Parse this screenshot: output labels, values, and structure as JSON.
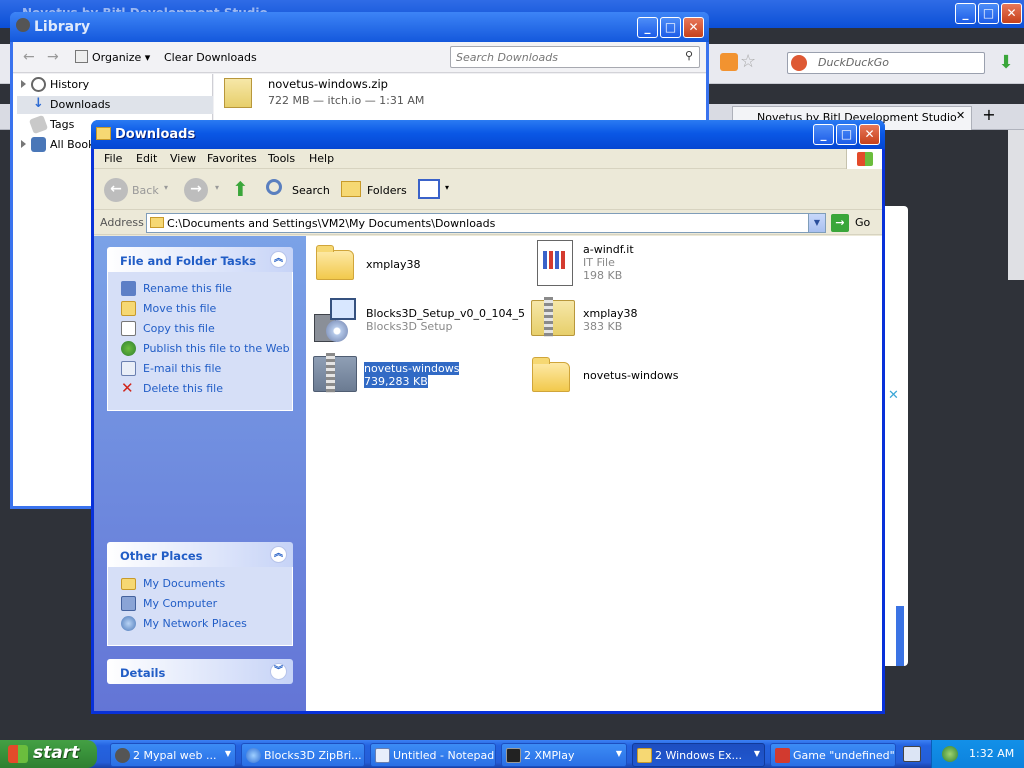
{
  "firefox": {
    "search_placeholder": "DuckDuckGo",
    "tab_label": "Novetus by Bitl Development Studio"
  },
  "library": {
    "title": "Library",
    "organize_label": "Organize",
    "clear_label": "Clear Downloads",
    "search_placeholder": "Search Downloads",
    "tree": [
      {
        "label": "History"
      },
      {
        "label": "Downloads"
      },
      {
        "label": "Tags"
      },
      {
        "label": "All Bookmarks"
      }
    ],
    "download": {
      "name": "novetus-windows.zip",
      "meta": "722 MB — itch.io — 1:31 AM"
    }
  },
  "explorer": {
    "title": "Downloads",
    "menu": [
      "File",
      "Edit",
      "View",
      "Favorites",
      "Tools",
      "Help"
    ],
    "toolbar": {
      "back": "Back",
      "search": "Search",
      "folders": "Folders"
    },
    "address_label": "Address",
    "address": "C:\\Documents and Settings\\VM2\\My Documents\\Downloads",
    "go_label": "Go",
    "file_tasks": {
      "title": "File and Folder Tasks",
      "items": [
        "Rename this file",
        "Move this file",
        "Copy this file",
        "Publish this file to the Web",
        "E-mail this file",
        "Delete this file"
      ]
    },
    "other_places": {
      "title": "Other Places",
      "items": [
        "My Documents",
        "My Computer",
        "My Network Places"
      ]
    },
    "details": {
      "title": "Details"
    },
    "files": [
      {
        "name": "xmplay38",
        "info": "",
        "size": "",
        "kind": "folder"
      },
      {
        "name": "a-windf.it",
        "info": "IT File",
        "size": "198 KB",
        "kind": "doc"
      },
      {
        "name": "Blocks3D_Setup_v0_0_104_5",
        "info": "Blocks3D Setup",
        "size": "",
        "kind": "setup"
      },
      {
        "name": "xmplay38",
        "info": "383 KB",
        "size": "",
        "kind": "zip"
      },
      {
        "name": "novetus-windows",
        "info": "739,283 KB",
        "size": "",
        "kind": "zip-grey"
      },
      {
        "name": "novetus-windows",
        "info": "",
        "size": "",
        "kind": "folder"
      }
    ]
  },
  "taskbar": {
    "start": "start",
    "buttons": [
      "2 Mypal web ...",
      "Blocks3D ZipBri...",
      "Untitled - Notepad",
      "2 XMPlay",
      "2 Windows Ex...",
      "Game \"undefined\""
    ],
    "clock": "1:32 AM"
  }
}
